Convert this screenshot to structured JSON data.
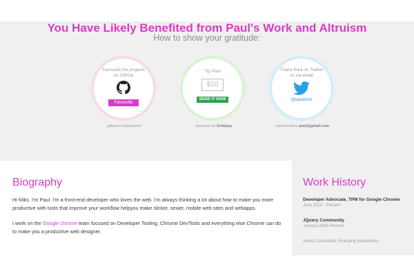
{
  "header": {
    "title": "You Have Likely Benefited from Paul's Work and Altruism",
    "subtitle": "How to show your gratitude:"
  },
  "gratitude": {
    "github": {
      "text": "Favourite his projects on GitHub",
      "button": "Favourite",
      "caption": "github.com/paulirish",
      "icon": "github-octocat-icon"
    },
    "tip": {
      "text": "Tip Paul",
      "amount_placeholder": "$10",
      "button": "SEND IT NOW",
      "caption_prefix": "powered by",
      "caption_brand": "Gratipay"
    },
    "twitter": {
      "text": "Thank Paul on Twitter or via email",
      "handle": "@paulirish",
      "caption_prefix": "send email to",
      "caption_email": "paul@gmail.com",
      "icon": "twitter-bird-icon"
    }
  },
  "biography": {
    "heading": "Biography",
    "p1": "Hi folks. I'm Paul. I'm a front-end developer who loves the web. I'm always thinking a lot about how to make you more productive with tools that improve your workflow helpyou make slicker, sexier, mobile web sites and webapps.",
    "p2_pre": "I work on the ",
    "p2_link": "Google chrome",
    "p2_post": " team focused on Developer Tooling, Chrome DevTools and everything else Chrome can do to make you a productive web designer."
  },
  "work_history": {
    "heading": "Work History",
    "jobs": [
      {
        "title": "Developer Advocate, TPM for Google Chrome",
        "dates": "June 2010 - Present"
      },
      {
        "title": "JQuery Community",
        "dates": "January 2008-Present"
      },
      {
        "title": "Senior Consultant, Emerging Interactions",
        "dates": ""
      }
    ]
  },
  "colors": {
    "accent": "#d63cc9",
    "send_button": "#2ea44f",
    "twitter": "#2a9fe2",
    "panel_bg": "#f0f0f0"
  }
}
